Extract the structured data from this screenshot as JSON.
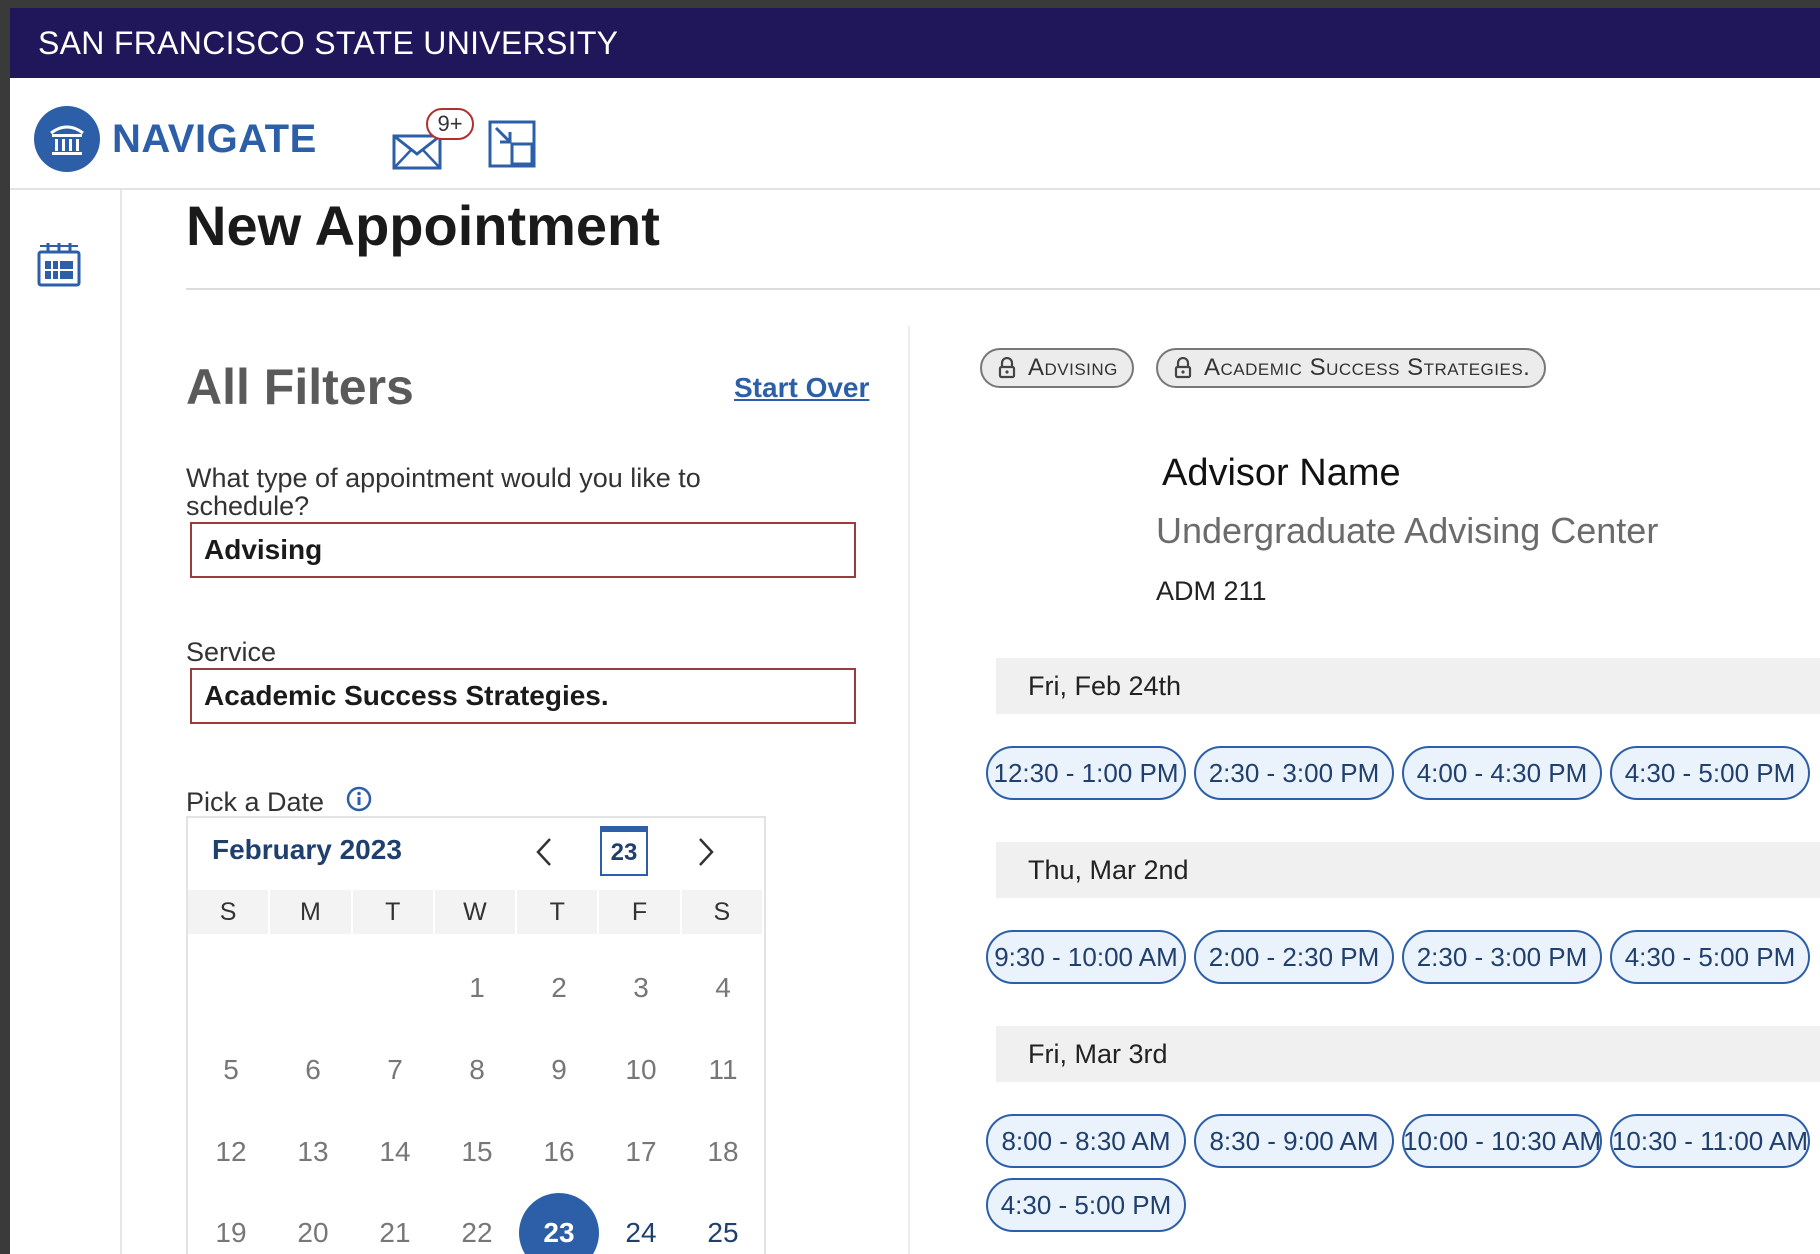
{
  "university": "SAN FRANCISCO STATE UNIVERSITY",
  "app": {
    "brand": "NAVIGATE",
    "notifications_badge": "9+"
  },
  "page": {
    "title": "New Appointment"
  },
  "filters": {
    "title": "All Filters",
    "start_over": "Start Over",
    "type_label": "What type of appointment would you like to schedule?",
    "type_value": "Advising",
    "service_label": "Service",
    "service_value": "Academic Success Strategies.",
    "date_label": "Pick a Date"
  },
  "calendar": {
    "month": "February 2023",
    "today": "23",
    "weekdays": [
      "S",
      "M",
      "T",
      "W",
      "T",
      "F",
      "S"
    ],
    "days": {
      "d1": "1",
      "d2": "2",
      "d3": "3",
      "d4": "4",
      "d5": "5",
      "d6": "6",
      "d7": "7",
      "d8": "8",
      "d9": "9",
      "d10": "10",
      "d11": "11",
      "d12": "12",
      "d13": "13",
      "d14": "14",
      "d15": "15",
      "d16": "16",
      "d17": "17",
      "d18": "18",
      "d19": "19",
      "d20": "20",
      "d21": "21",
      "d22": "22",
      "d23": "23",
      "d24": "24",
      "d25": "25"
    },
    "selected_day": 23
  },
  "chips": [
    "Advising",
    "Academic Success Strategies."
  ],
  "advisor": {
    "name": "Advisor Name",
    "department": "Undergraduate Advising Center",
    "location": "ADM 211"
  },
  "days": [
    {
      "date": "Fri, Feb 24th",
      "slots": [
        "12:30 - 1:00 PM",
        "2:30 - 3:00 PM",
        "4:00 - 4:30 PM",
        "4:30 - 5:00 PM"
      ]
    },
    {
      "date": "Thu, Mar 2nd",
      "slots": [
        "9:30 - 10:00 AM",
        "2:00 - 2:30 PM",
        "2:30 - 3:00 PM",
        "4:30 - 5:00 PM"
      ]
    },
    {
      "date": "Fri, Mar 3rd",
      "slots": [
        "8:00 - 8:30 AM",
        "8:30 - 9:00 AM",
        "10:00 - 10:30 AM",
        "10:30 - 11:00 AM",
        "4:30 - 5:00 PM"
      ]
    }
  ],
  "colors": {
    "banner": "#20175b",
    "brand_blue": "#2c5fa8",
    "field_border": "#9b3b3b"
  }
}
